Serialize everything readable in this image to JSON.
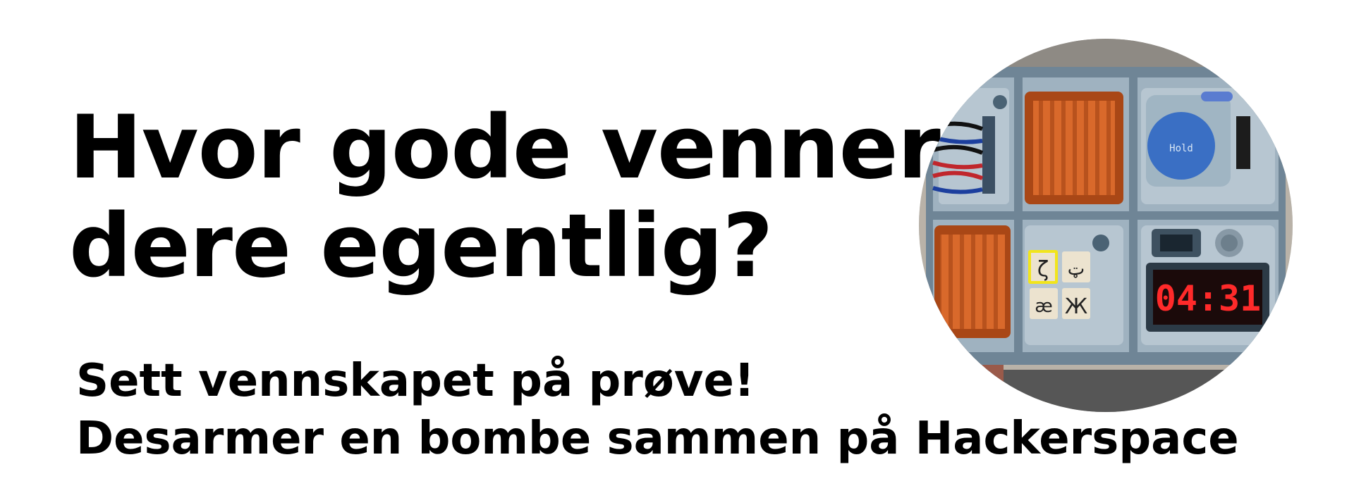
{
  "headline": {
    "line1": "Hvor gode venner er",
    "line2": "dere egentlig?"
  },
  "subheadline": {
    "line1": "Sett vennskapet på prøve!",
    "line2": "Desarmer en bombe sammen på Hackerspace"
  },
  "game_image": {
    "button_label": "Hold",
    "timer": "04:31",
    "keypad_symbols": [
      "ζ",
      "ټ",
      "æ",
      "Ж"
    ]
  },
  "colors": {
    "text": "#000000",
    "background": "#ffffff",
    "panel_metal": "#8fa3b3",
    "orange_vent": "#d9692b",
    "button_blue": "#3a6fc4",
    "timer_red": "#ff2a2a",
    "keypad_highlight": "#f2e51b"
  }
}
